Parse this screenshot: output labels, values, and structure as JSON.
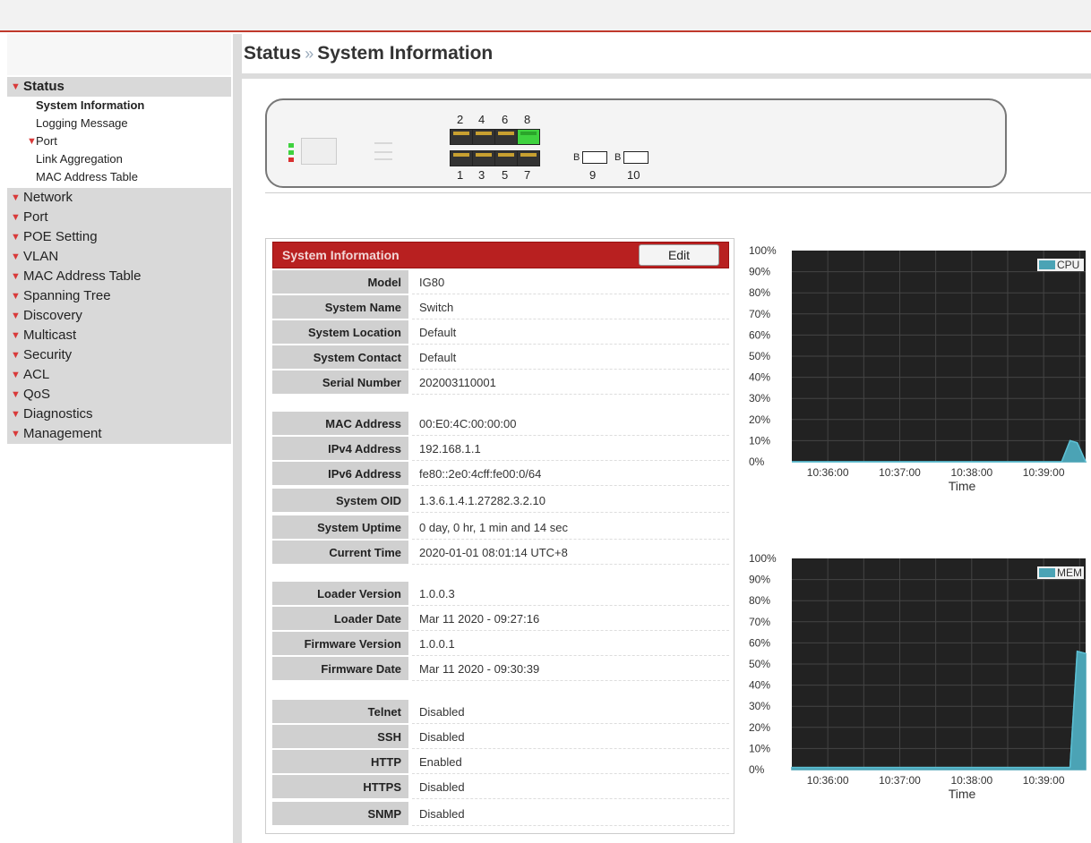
{
  "header": {
    "breadcrumb_parent": "Status",
    "breadcrumb_sep": "»",
    "title": "System Information"
  },
  "sidebar": {
    "groups": [
      {
        "label": "Status",
        "expanded": true
      },
      {
        "label": "Network"
      },
      {
        "label": "Port"
      },
      {
        "label": "POE Setting"
      },
      {
        "label": "VLAN"
      },
      {
        "label": "MAC Address Table"
      },
      {
        "label": "Spanning Tree"
      },
      {
        "label": "Discovery"
      },
      {
        "label": "Multicast"
      },
      {
        "label": "Security"
      },
      {
        "label": "ACL"
      },
      {
        "label": "QoS"
      },
      {
        "label": "Diagnostics"
      },
      {
        "label": "Management"
      }
    ],
    "status_items": [
      {
        "label": "System Information",
        "active": true
      },
      {
        "label": "Logging Message"
      },
      {
        "label": "Port",
        "has_chevron": true
      },
      {
        "label": "Link Aggregation"
      },
      {
        "label": "MAC Address Table"
      }
    ]
  },
  "device": {
    "top_ports": [
      "2",
      "4",
      "6",
      "8"
    ],
    "bottom_ports": [
      "1",
      "3",
      "5",
      "7"
    ],
    "sfp_ports": [
      "9",
      "10"
    ],
    "port_up": "8",
    "sfp_mark": "B"
  },
  "info": {
    "title": "System Information",
    "edit_label": "Edit",
    "rows": [
      {
        "label": "Model",
        "value": "IG80"
      },
      {
        "label": "System Name",
        "value": "Switch"
      },
      {
        "label": "System Location",
        "value": "Default"
      },
      {
        "label": "System Contact",
        "value": "Default"
      },
      {
        "label": "Serial Number",
        "value": "202003110001"
      },
      {
        "label": "MAC Address",
        "value": "00:E0:4C:00:00:00"
      },
      {
        "label": "IPv4 Address",
        "value": "192.168.1.1"
      },
      {
        "label": "IPv6 Address",
        "value": "fe80::2e0:4cff:fe00:0/64"
      },
      {
        "label": "System OID",
        "value": "1.3.6.1.4.1.27282.3.2.10"
      },
      {
        "label": "System Uptime",
        "value": "0 day, 0 hr, 1 min and 14 sec"
      },
      {
        "label": "Current Time",
        "value": "2020-01-01 08:01:14 UTC+8"
      },
      {
        "label": "Loader Version",
        "value": "1.0.0.3"
      },
      {
        "label": "Loader Date",
        "value": "Mar 11 2020 - 09:27:16"
      },
      {
        "label": "Firmware Version",
        "value": "1.0.0.1"
      },
      {
        "label": "Firmware Date",
        "value": "Mar 11 2020 - 09:30:39"
      },
      {
        "label": "Telnet",
        "value": "Disabled"
      },
      {
        "label": "SSH",
        "value": "Disabled"
      },
      {
        "label": "HTTP",
        "value": "Enabled"
      },
      {
        "label": "HTTPS",
        "value": "Disabled"
      },
      {
        "label": "SNMP",
        "value": "Disabled"
      }
    ]
  },
  "colors": {
    "accent_red": "#b82020",
    "chart_bg": "#222222",
    "series_fill": "#4ba3b5",
    "sidebar_chevron": "#d93a3a"
  },
  "chart_data": [
    {
      "type": "area",
      "series": [
        {
          "name": "CPU",
          "x": [
            "10:35:30",
            "10:36:00",
            "10:36:30",
            "10:37:00",
            "10:37:30",
            "10:38:00",
            "10:38:30",
            "10:39:00",
            "10:39:15",
            "10:39:22",
            "10:39:28",
            "10:39:35"
          ],
          "values": [
            0,
            0,
            0,
            0,
            0,
            0,
            0,
            0,
            0,
            10,
            9,
            0
          ]
        }
      ],
      "xlabel": "Time",
      "x_ticks": [
        "10:36:00",
        "10:37:00",
        "10:38:00",
        "10:39:00"
      ],
      "y_ticks": [
        "0%",
        "10%",
        "20%",
        "30%",
        "40%",
        "50%",
        "60%",
        "70%",
        "80%",
        "90%",
        "100%"
      ],
      "ylim": [
        0,
        100
      ],
      "legend": "top-right",
      "grid": true
    },
    {
      "type": "area",
      "series": [
        {
          "name": "MEM",
          "x": [
            "10:35:30",
            "10:36:00",
            "10:36:30",
            "10:37:00",
            "10:37:30",
            "10:38:00",
            "10:38:30",
            "10:39:00",
            "10:39:15",
            "10:39:22",
            "10:39:28",
            "10:39:35"
          ],
          "values": [
            1,
            1,
            1,
            1,
            1,
            1,
            1,
            1,
            1,
            1,
            56,
            55
          ]
        }
      ],
      "xlabel": "Time",
      "x_ticks": [
        "10:36:00",
        "10:37:00",
        "10:38:00",
        "10:39:00"
      ],
      "y_ticks": [
        "0%",
        "10%",
        "20%",
        "30%",
        "40%",
        "50%",
        "60%",
        "70%",
        "80%",
        "90%",
        "100%"
      ],
      "ylim": [
        0,
        100
      ],
      "legend": "top-right",
      "grid": true
    }
  ]
}
